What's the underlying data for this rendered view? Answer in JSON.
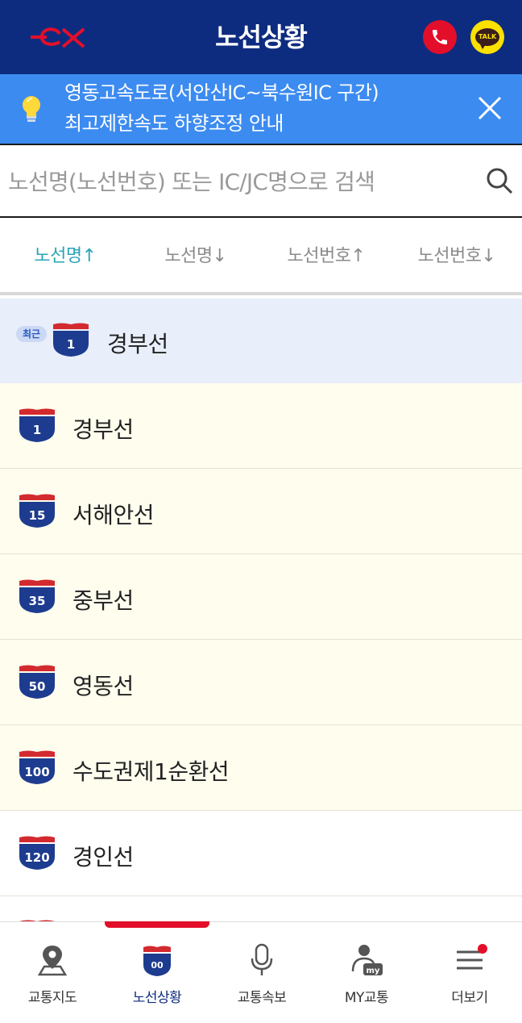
{
  "header": {
    "title": "노선상황",
    "logo_text": "ex",
    "talk_label": "TALK"
  },
  "notice": {
    "line1": "영동고속도로(서안산IC~북수원IC 구간)",
    "line2": "최고제한속도 하향조정 안내"
  },
  "search": {
    "placeholder": "노선명(노선번호) 또는 IC/JC명으로 검색",
    "value": ""
  },
  "sort_tabs": [
    {
      "label": "노선명↑",
      "active": true
    },
    {
      "label": "노선명↓",
      "active": false
    },
    {
      "label": "노선번호↑",
      "active": false
    },
    {
      "label": "노선번호↓",
      "active": false
    }
  ],
  "recent": {
    "badge": "최근",
    "number": "1",
    "name": "경부선"
  },
  "routes": [
    {
      "number": "1",
      "name": "경부선"
    },
    {
      "number": "15",
      "name": "서해안선"
    },
    {
      "number": "35",
      "name": "중부선"
    },
    {
      "number": "50",
      "name": "영동선"
    },
    {
      "number": "100",
      "name": "수도권제1순환선"
    },
    {
      "number": "120",
      "name": "경인선"
    }
  ],
  "bottom_nav": [
    {
      "label": "교통지도",
      "icon": "map-pin-icon",
      "active": false
    },
    {
      "label": "노선상황",
      "icon": "route-shield-icon",
      "active": true
    },
    {
      "label": "교통속보",
      "icon": "microphone-icon",
      "active": false
    },
    {
      "label": "MY교통",
      "icon": "my-user-icon",
      "active": false
    },
    {
      "label": "더보기",
      "icon": "menu-icon",
      "active": false
    }
  ],
  "colors": {
    "header_bg": "#0e2c7f",
    "notice_bg": "#3c8bf0",
    "accent_red": "#e30f2a",
    "active_sort": "#2aa3b8",
    "recent_row_bg": "#e9eefb",
    "route_row_bg": "#fffdee"
  }
}
